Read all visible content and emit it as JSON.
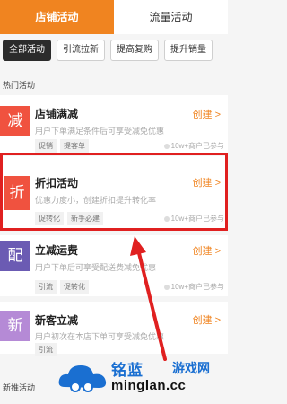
{
  "tabs": [
    {
      "label": "店铺活动",
      "active": true
    },
    {
      "label": "流量活动",
      "active": false
    }
  ],
  "filters": [
    {
      "label": "全部活动",
      "active": true
    },
    {
      "label": "引流拉新",
      "active": false
    },
    {
      "label": "提高复购",
      "active": false
    },
    {
      "label": "提升销量",
      "active": false
    }
  ],
  "section_hot": "热门活动",
  "section_new": "新推活动",
  "create_label": "创建",
  "merchant_count": "10w+商户已参与",
  "cards": [
    {
      "tile": "减",
      "color": "#f0523f",
      "title": "店铺满减",
      "desc": "用户下单满足条件后可享受减免优惠",
      "tags": [
        "促销",
        "提客单"
      ]
    },
    {
      "tile": "折",
      "color": "#f0523f",
      "title": "折扣活动",
      "desc": "优惠力度小，创建折扣提升转化率",
      "tags": [
        "促转化",
        "新手必建"
      ]
    },
    {
      "tile": "配",
      "color": "#6b5bb3",
      "title": "立减运费",
      "desc": "用户下单后可享受配送费减免优惠",
      "tags": [
        "引流",
        "促转化"
      ]
    },
    {
      "tile": "新",
      "color": "#b58ad6",
      "title": "新客立减",
      "desc": "用户初次在本店下单可享受减免优惠",
      "tags": [
        "引流"
      ]
    }
  ],
  "watermark": {
    "brand": "铭蓝",
    "site": "游戏网",
    "domain": "minglan.cc",
    "color": "#1a6fd1"
  }
}
